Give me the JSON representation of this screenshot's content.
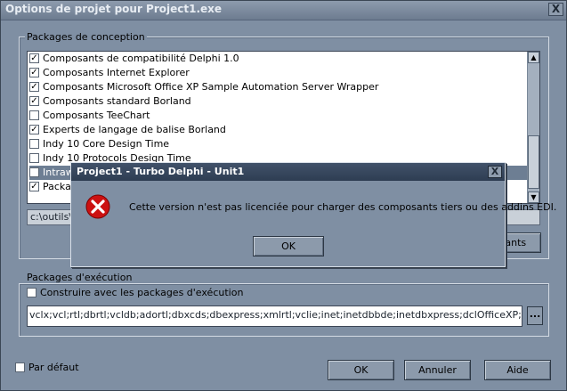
{
  "window": {
    "title": "Options de projet pour Project1.exe",
    "close_label": "X"
  },
  "design_packages": {
    "title": "Packages de conception",
    "items": [
      {
        "label": "Composants de compatibilité Delphi 1.0",
        "checked": true
      },
      {
        "label": "Composants Internet Explorer",
        "checked": true
      },
      {
        "label": "Composants Microsoft Office XP Sample Automation Server Wrapper",
        "checked": true
      },
      {
        "label": "Composants standard Borland",
        "checked": true
      },
      {
        "label": "Composants TeeChart",
        "checked": false
      },
      {
        "label": "Experts de langage de balise Borland",
        "checked": true
      },
      {
        "label": "Indy 10 Core Design Time",
        "checked": false
      },
      {
        "label": "Indy 10 Protocols Design Time",
        "checked": false
      },
      {
        "label": "Intrawe",
        "checked": true,
        "selected": true
      },
      {
        "label": "Packag",
        "checked": true
      }
    ],
    "path": "c:\\outils\\be",
    "components_button": "osants"
  },
  "runtime_packages": {
    "title": "Packages d'exécution",
    "build_with_label": "Construire avec les packages d'exécution",
    "build_with_checked": false,
    "list_value": "vclx;vcl;rtl;dbrtl;vcldb;adortl;dbxcds;dbexpress;xmlrtl;vclie;inet;inetdbbde;inetdbxpress;dclOfficeXP;soaprtl;dsnap;",
    "ellipsis": "..."
  },
  "footer": {
    "default_label": "Par défaut",
    "ok": "OK",
    "cancel": "Annuler",
    "help": "Aide"
  },
  "error_dialog": {
    "title": "Project1 - Turbo Delphi - Unit1",
    "close_label": "X",
    "message": "Cette version n'est pas licenciée pour charger des composants tiers ou des addins EDI.",
    "ok": "OK",
    "icon": "error-icon"
  }
}
